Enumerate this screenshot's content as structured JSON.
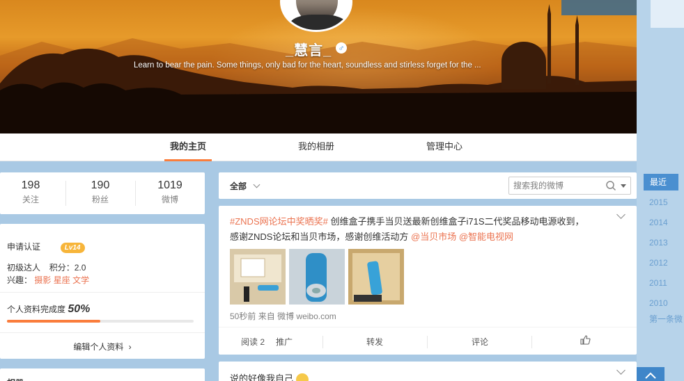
{
  "profile": {
    "nickname": "_慧言_",
    "gender_symbol": "♂",
    "motto": "Learn to bear the pain. Some things, only bad for the heart, soundless and stirless forget for the ..."
  },
  "tabs": [
    {
      "label": "我的主页",
      "active": true
    },
    {
      "label": "我的相册",
      "active": false
    },
    {
      "label": "管理中心",
      "active": false
    }
  ],
  "stats": [
    {
      "value": "198",
      "label": "关注"
    },
    {
      "value": "190",
      "label": "粉丝"
    },
    {
      "value": "1019",
      "label": "微博"
    }
  ],
  "info": {
    "verify": "申请认证",
    "level": "Lv14",
    "rank": "初级达人",
    "points_label": "积分：",
    "points": "2.0",
    "interests_label": "兴趣：",
    "interests": [
      "摄影",
      "星座",
      "文学"
    ],
    "completion_label": "个人资料完成度",
    "completion": "50%",
    "completion_fraction": 0.5,
    "edit": "编辑个人资料"
  },
  "photos_card": {
    "title": "相册"
  },
  "feed": {
    "filter": "全部",
    "search_placeholder": "搜索我的微博",
    "post": {
      "topic": "#ZNDS网论坛中奖晒奖#",
      "text1": " 创维盒子携手当贝送最新创维盒子i71S二代奖品移动电源收到，",
      "text2": "感谢ZNDS论坛和当贝市场，感谢创维活动方 ",
      "mention1": "@当贝市场",
      "mention2": "@智能电视网",
      "time": "50秒前",
      "source_prefix": "来自",
      "source": "微博 weibo.com",
      "actions": {
        "read": "阅读 2",
        "promote": "推广",
        "repost": "转发",
        "comment": "评论"
      }
    },
    "post2": {
      "text": "说的好像我自己"
    }
  },
  "timeline": {
    "recent": "最近",
    "years": [
      "2015",
      "2014",
      "2013",
      "2012",
      "2011",
      "2010"
    ],
    "first": "第一条微"
  },
  "colors": {
    "accent": "#fa7d3c",
    "link": "#eb7350",
    "timeline_blue": "#4a8fd0"
  }
}
